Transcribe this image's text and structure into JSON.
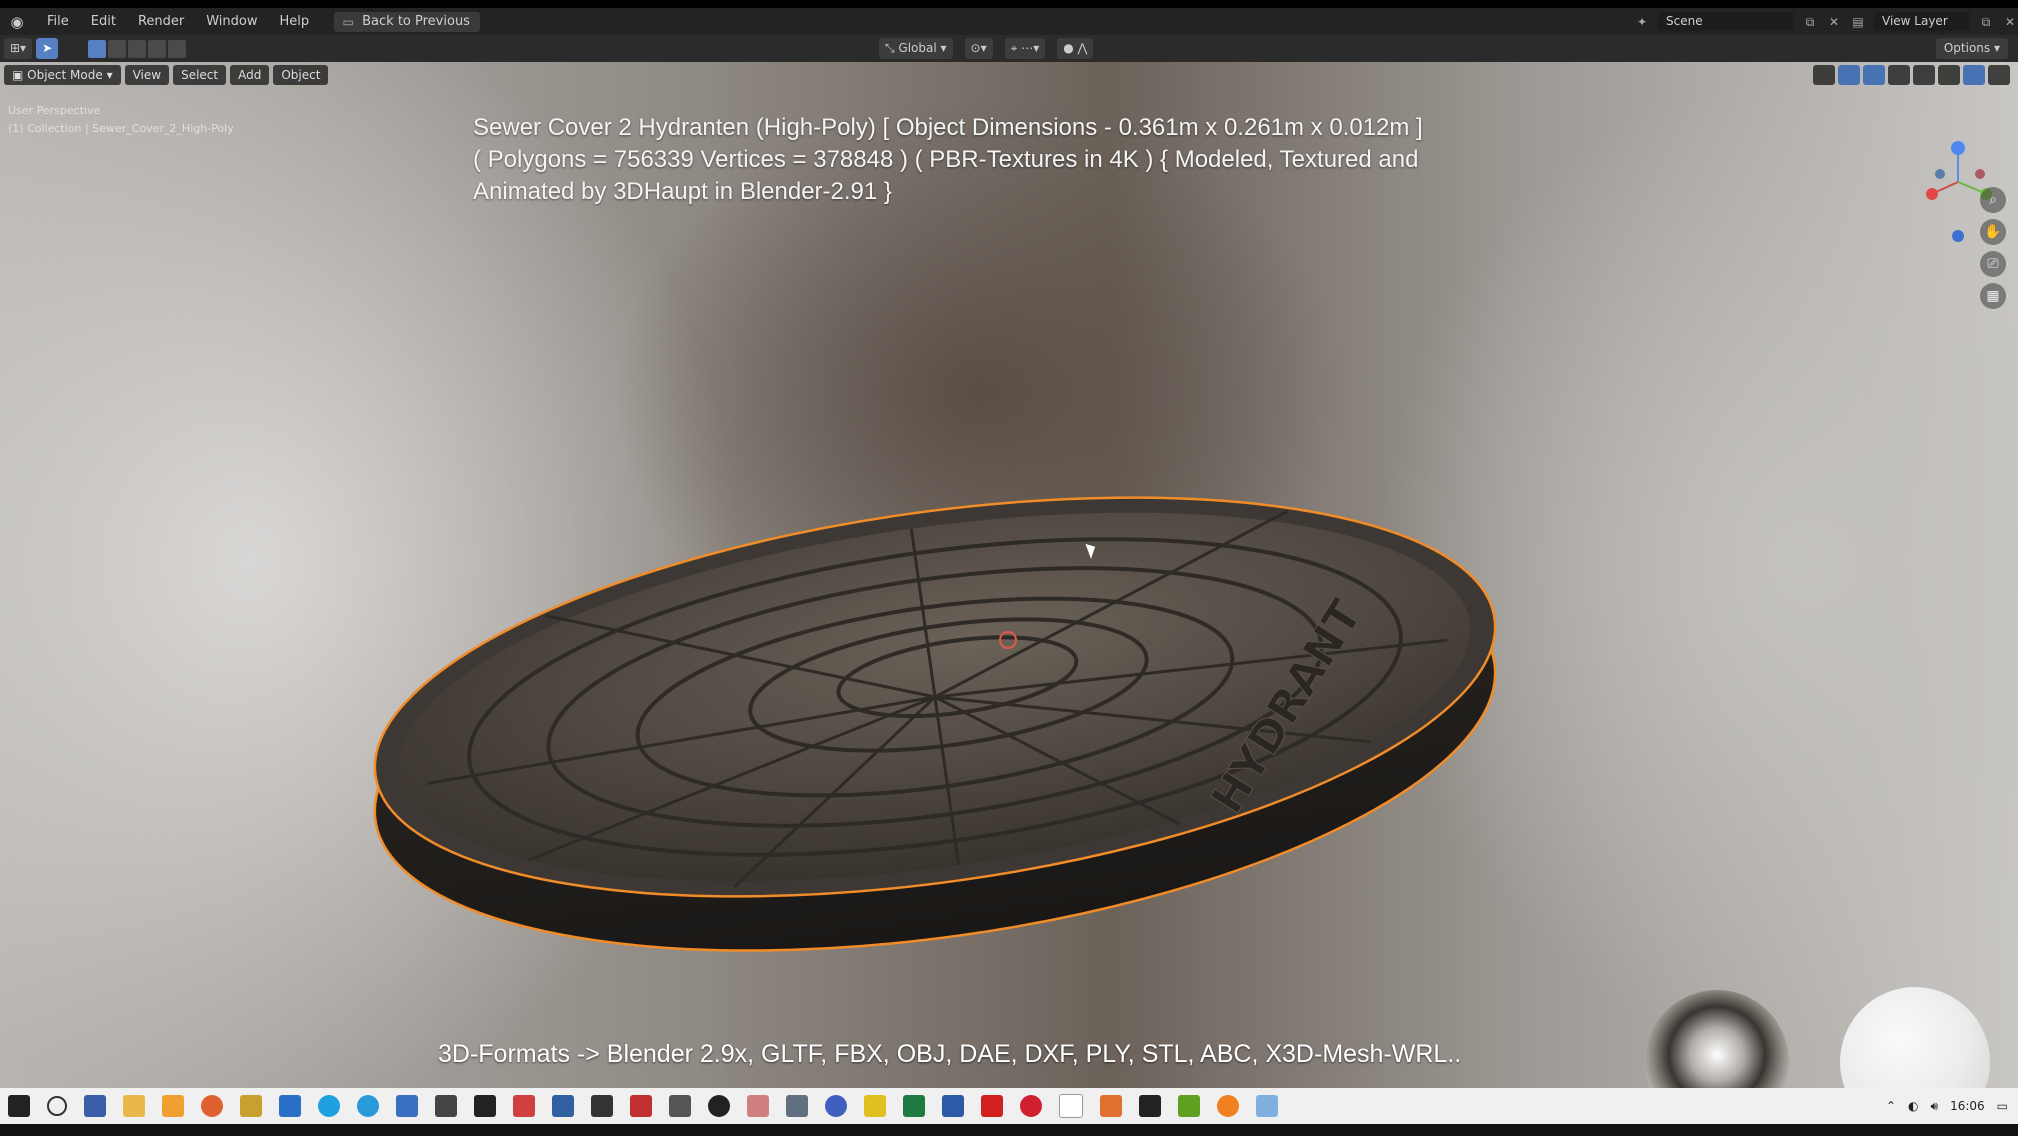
{
  "app": {
    "menu": [
      "File",
      "Edit",
      "Render",
      "Window",
      "Help"
    ],
    "back_button": "Back to Previous",
    "scene_label": "Scene",
    "view_layer_label": "View Layer"
  },
  "toolbar": {
    "orientation": "Global",
    "options": "Options"
  },
  "viewport_header": {
    "mode": "Object Mode",
    "menus": [
      "View",
      "Select",
      "Add",
      "Object"
    ]
  },
  "overlay": {
    "perspective": "User Perspective",
    "collection": "(1) Collection | Sewer_Cover_2_High-Poly"
  },
  "title_lines": [
    "Sewer Cover 2 Hydranten (High-Poly) [ Object Dimensions -  0.361m x 0.261m x 0.012m ]",
    "( Polygons = 756339 Vertices = 378848 ) ( PBR-Textures in 4K ) { Modeled, Textured and",
    "Animated by 3DHaupt in Blender-2.91 }"
  ],
  "formats_line": "3D-Formats -> Blender 2.9x, GLTF, FBX, OBJ, DAE, DXF, PLY, STL, ABC, X3D-Mesh-WRL..",
  "model": {
    "embossed_text": "HYDRANT"
  },
  "taskbar": {
    "clock": "16:06"
  },
  "colors": {
    "selection_outline": "#f28c28",
    "accent": "#4772b3"
  }
}
